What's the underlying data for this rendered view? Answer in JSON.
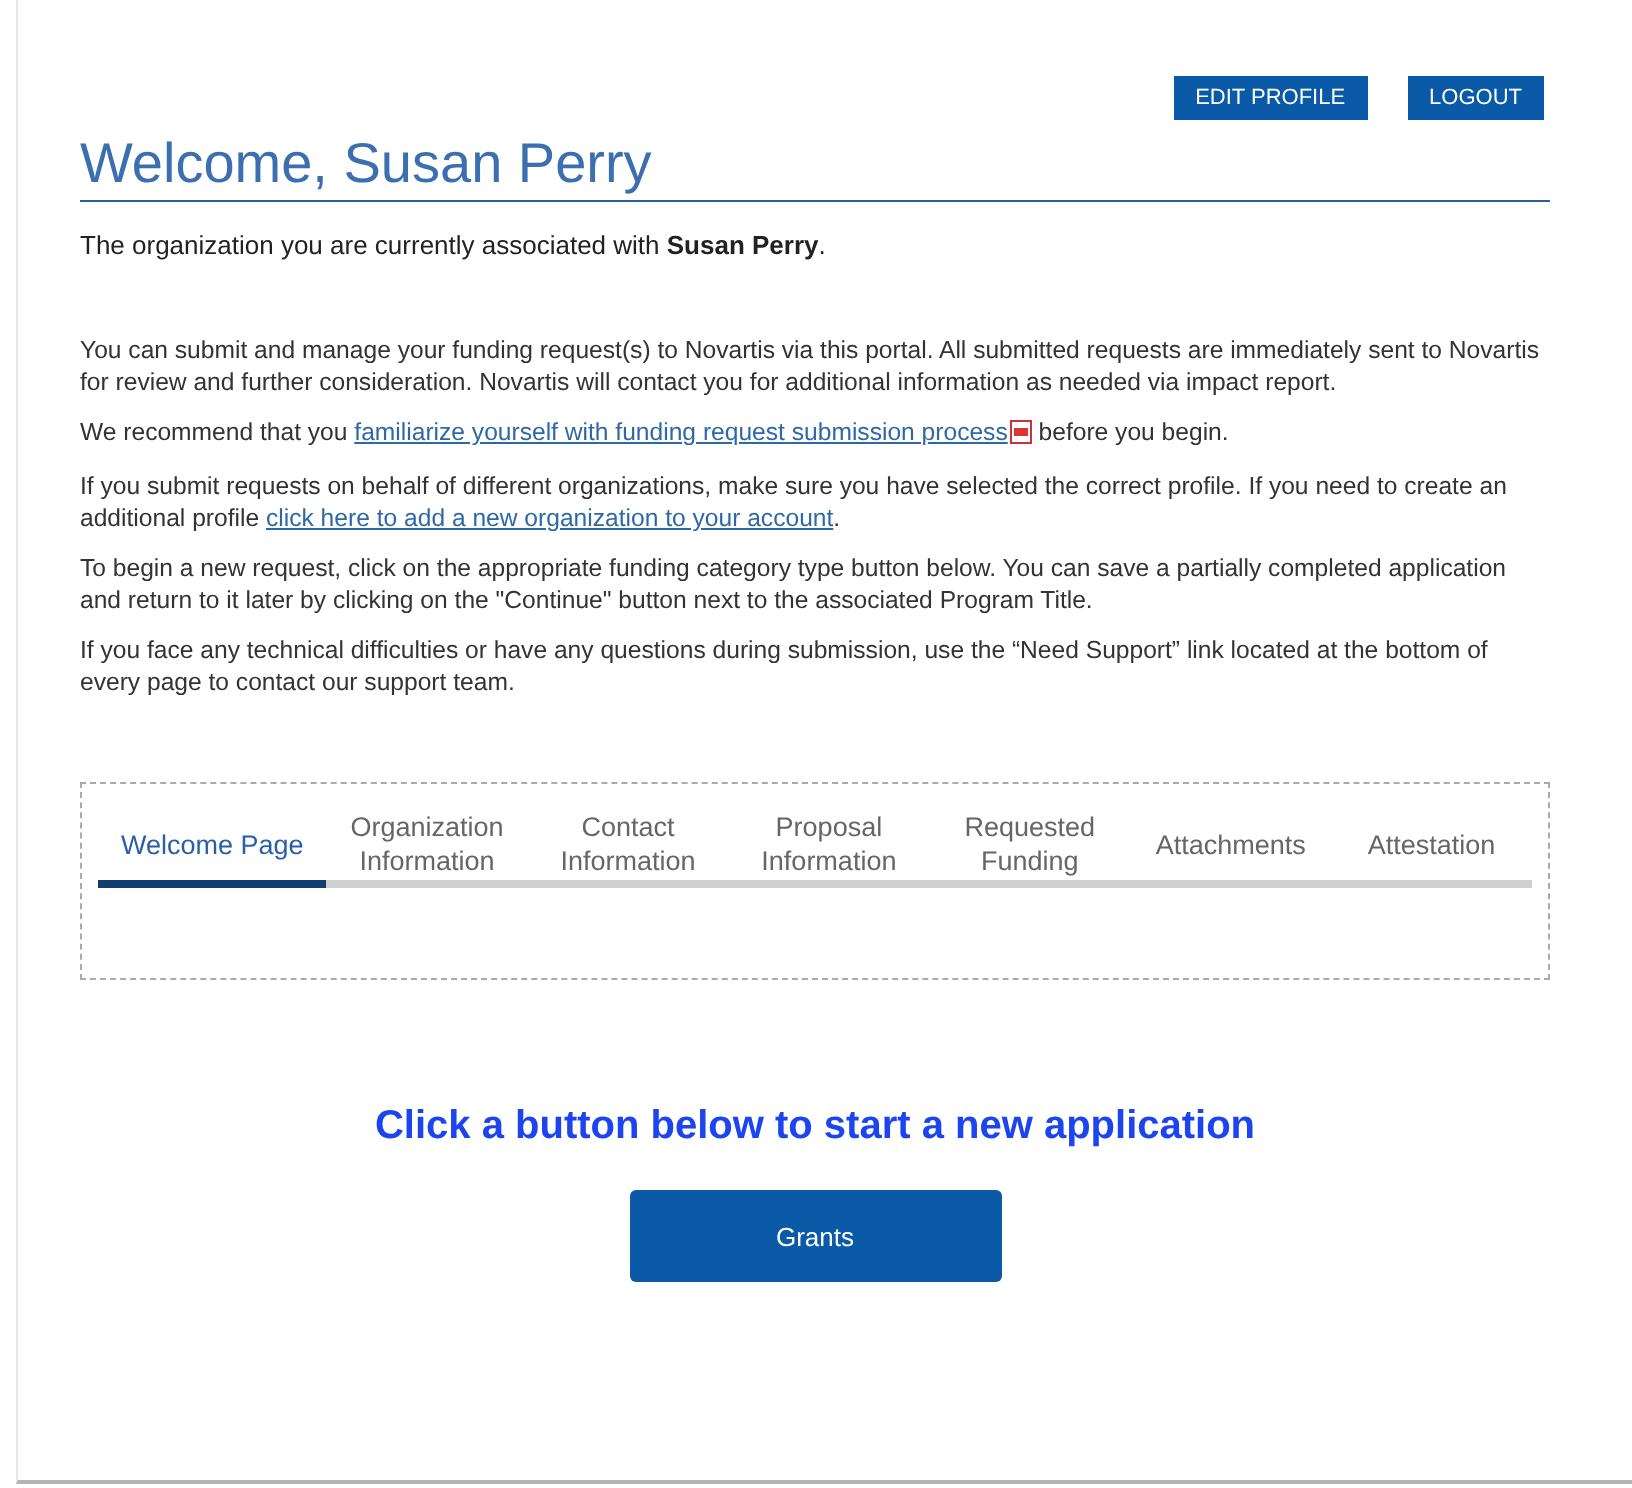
{
  "header": {
    "buttons": [
      "EDIT PROFILE",
      "LOGOUT"
    ]
  },
  "title": "Welcome, Susan Perry",
  "organization_line": "The organization you are currently associated with  **Susan Perry**.",
  "paragraphs": [
    {
      "segments": [
        {
          "kind": "text",
          "text": "You can submit and manage your funding request(s) to Novartis via this portal. All submitted requests are immediately sent to Novartis for review and further consideration. Novartis will contact you for additional information as needed via impact report."
        }
      ]
    },
    {
      "segments": [
        {
          "kind": "text",
          "text": "We recommend that you "
        },
        {
          "kind": "pdf-link",
          "text": "familiarize yourself with funding request submission process"
        },
        {
          "kind": "text",
          "text": " before you begin."
        }
      ]
    },
    {
      "segments": [
        {
          "kind": "text",
          "text": "If you submit requests on behalf of different organizations, make sure you have selected the correct profile. If you need to create an additional profile "
        },
        {
          "kind": "link",
          "text": "click here to add a new organization to your account"
        },
        {
          "kind": "text",
          "text": "."
        }
      ]
    },
    {
      "segments": [
        {
          "kind": "text",
          "text": "To begin a new request, click on the appropriate funding category type button below. You can save a partially completed application and return to it later by clicking on the \"Continue\" button next to the associated Program Title."
        }
      ]
    },
    {
      "segments": [
        {
          "kind": "text",
          "text": "If you face any technical difficulties or have any questions during submission, use the “Need Support” link located at the bottom of every page to contact our support team."
        }
      ]
    }
  ],
  "tabs": [
    {
      "label": "Welcome Page",
      "selected": true
    },
    {
      "label": "Organization Information",
      "selected": false
    },
    {
      "label": "Contact Information",
      "selected": false
    },
    {
      "label": "Proposal Information",
      "selected": false
    },
    {
      "label": "Requested Funding",
      "selected": false
    },
    {
      "label": "Attachments",
      "selected": false
    },
    {
      "label": "Attestation",
      "selected": false
    }
  ],
  "start_heading": "Click a button below to start a new application",
  "start_buttons": [
    "Grants"
  ]
}
